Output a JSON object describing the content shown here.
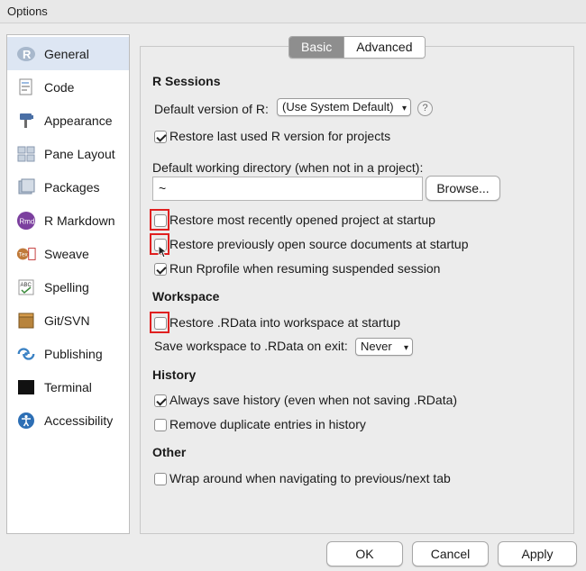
{
  "window": {
    "title": "Options"
  },
  "sidebar": {
    "items": [
      {
        "label": "General",
        "icon": "r-logo-icon",
        "active": true
      },
      {
        "label": "Code",
        "icon": "code-document-icon"
      },
      {
        "label": "Appearance",
        "icon": "paint-bucket-icon"
      },
      {
        "label": "Pane Layout",
        "icon": "pane-layout-icon"
      },
      {
        "label": "Packages",
        "icon": "package-icon"
      },
      {
        "label": "R Markdown",
        "icon": "rmd-icon"
      },
      {
        "label": "Sweave",
        "icon": "sweave-icon"
      },
      {
        "label": "Spelling",
        "icon": "spelling-abc-icon"
      },
      {
        "label": "Git/SVN",
        "icon": "git-box-icon"
      },
      {
        "label": "Publishing",
        "icon": "publishing-icon"
      },
      {
        "label": "Terminal",
        "icon": "terminal-icon"
      },
      {
        "label": "Accessibility",
        "icon": "accessibility-icon"
      }
    ]
  },
  "tabs": {
    "basic": "Basic",
    "advanced": "Advanced"
  },
  "r_sessions": {
    "title": "R Sessions",
    "default_version_label": "Default version of R:",
    "default_version_value": "(Use System Default)",
    "help_glyph": "?",
    "restore_version_label": "Restore last used R version for projects",
    "working_dir_label": "Default working directory (when not in a project):",
    "working_dir_value": "~",
    "browse_label": "Browse...",
    "restore_project_label": "Restore most recently opened project at startup",
    "restore_docs_label": "Restore previously open source documents at startup",
    "run_rprofile_label": "Run Rprofile when resuming suspended session"
  },
  "workspace": {
    "title": "Workspace",
    "restore_rdata_label": "Restore .RData into workspace at startup",
    "save_on_exit_label": "Save workspace to .RData on exit:",
    "save_on_exit_value": "Never"
  },
  "history": {
    "title": "History",
    "always_save_label": "Always save history (even when not saving .RData)",
    "remove_duplicates_label": "Remove duplicate entries in history"
  },
  "other": {
    "title": "Other",
    "wrap_around_label": "Wrap around when navigating to previous/next tab"
  },
  "buttons": {
    "ok": "OK",
    "cancel": "Cancel",
    "apply": "Apply"
  },
  "colors": {
    "highlight": "#e02020",
    "active_tab": "#8e8e8e",
    "active_sidebar": "#dde6f3"
  }
}
